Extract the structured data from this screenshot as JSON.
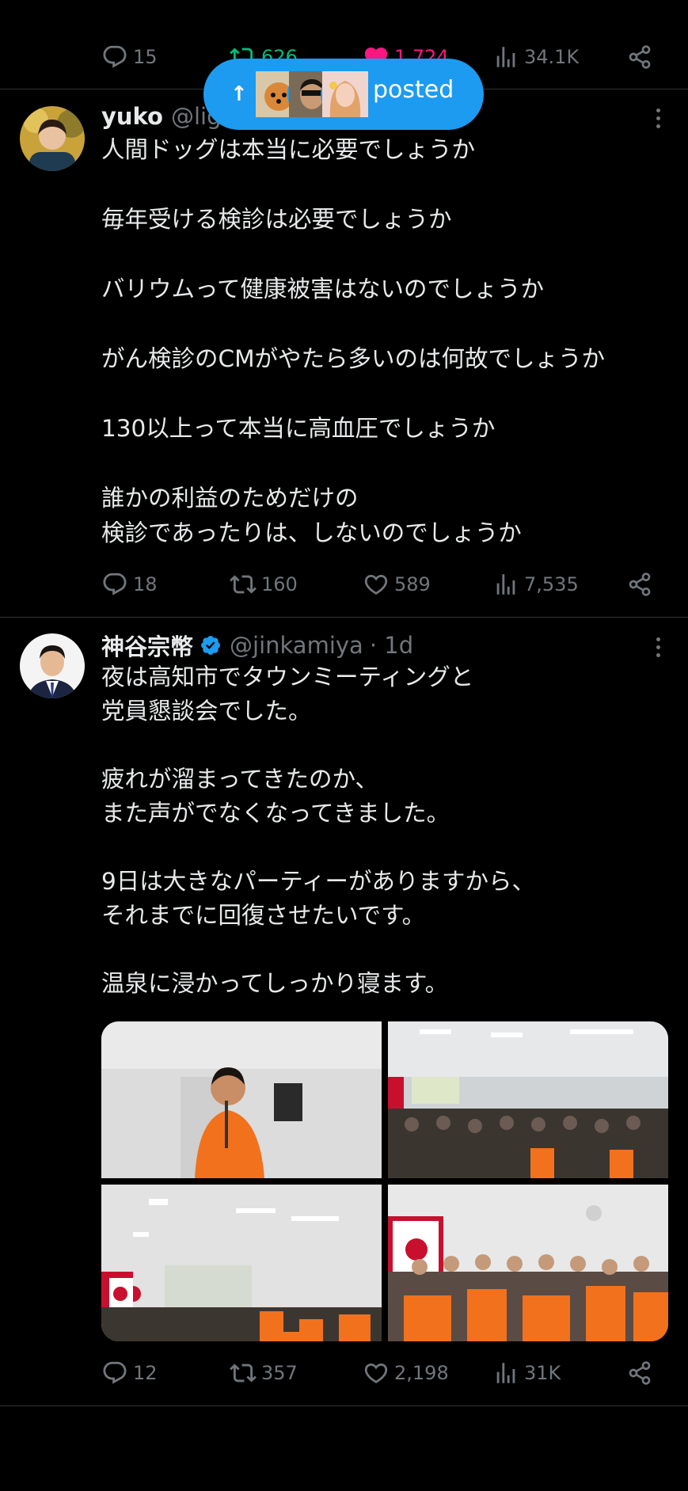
{
  "top_actions": {
    "replies": "15",
    "retweets": "626",
    "likes": "1,724",
    "views": "34.1K"
  },
  "new_posts_pill": {
    "label": "posted"
  },
  "tweet1": {
    "name": "yuko",
    "handle": "@lig",
    "lines": [
      "人間ドッグは本当に必要でしょうか",
      "",
      "毎年受ける検診は必要でしょうか",
      "",
      "バリウムって健康被害はないのでしょうか",
      "",
      "がん検診のCMがやたら多いのは何故でしょうか",
      "",
      "130以上って本当に高血圧でしょうか",
      "",
      "誰かの利益のためだけの",
      "検診であったりは、しないのでしょうか"
    ],
    "actions": {
      "replies": "18",
      "retweets": "160",
      "likes": "589",
      "views": "7,535"
    }
  },
  "tweet2": {
    "name": "神谷宗幣",
    "handle": "@jinkamiya",
    "time": "· 1d",
    "lines": [
      "夜は高知市でタウンミーティングと",
      "党員懇談会でした。",
      "",
      "疲れが溜まってきたのか、",
      "また声がでなくなってきました。",
      "",
      "9日は大きなパーティーがありますから、",
      "それまでに回復させたいです。",
      "",
      "温泉に浸かってしっかり寝ます。"
    ],
    "actions": {
      "replies": "12",
      "retweets": "357",
      "likes": "2,198",
      "views": "31K"
    }
  },
  "colors": {
    "background": "#000000",
    "text": "#e7e9ea",
    "muted": "#71767b",
    "accent": "#1d9bf0",
    "retweet_active": "#00ba7c",
    "like_active": "#f91880",
    "divider": "#2f3336"
  },
  "icons": [
    "reply-icon",
    "retweet-icon",
    "like-icon",
    "views-icon",
    "share-icon",
    "more-icon",
    "verified-icon",
    "arrow-up-icon"
  ]
}
